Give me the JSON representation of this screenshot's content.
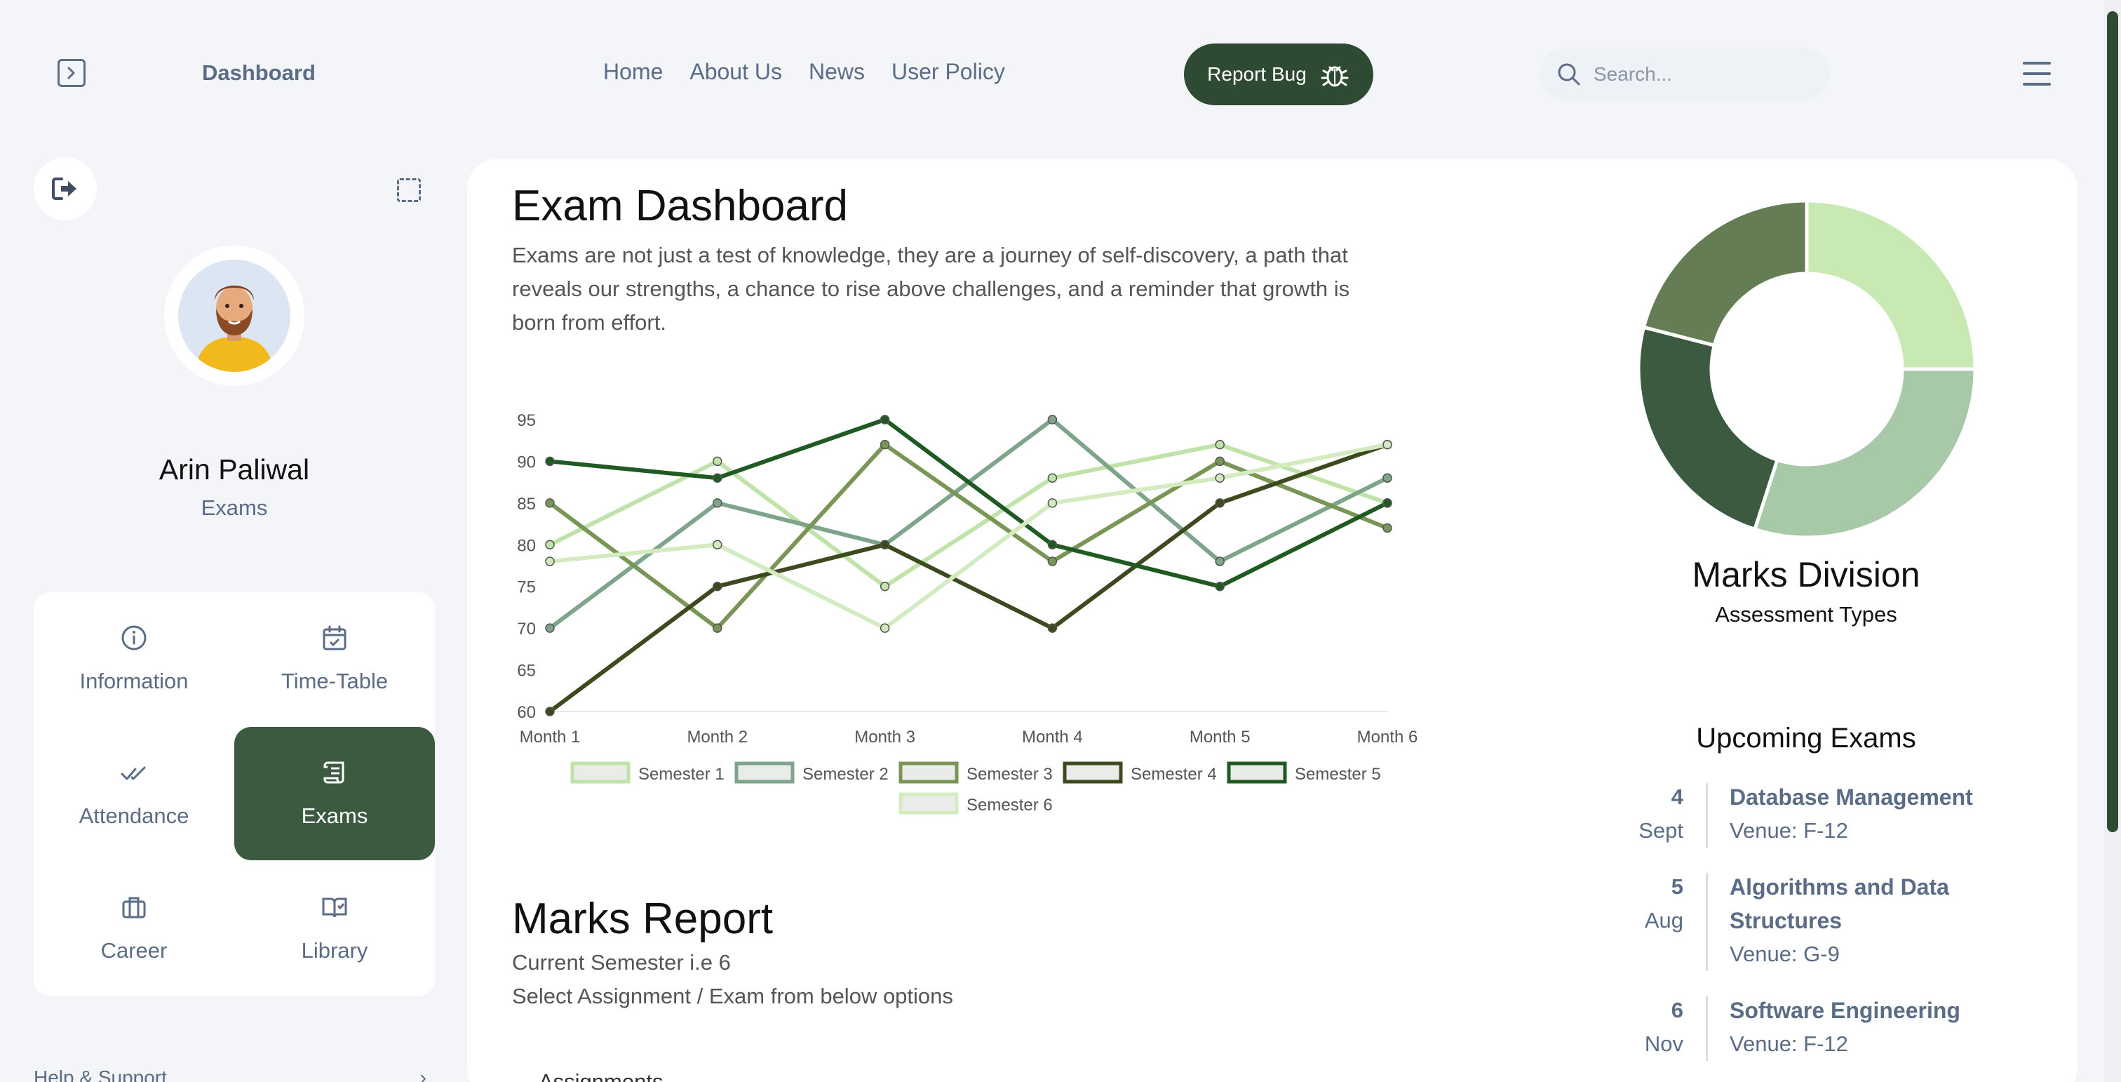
{
  "header": {
    "brand": "Dashboard",
    "nav": [
      "Home",
      "About Us",
      "News",
      "User Policy"
    ],
    "report_bug": "Report Bug",
    "search_placeholder": "Search..."
  },
  "sidebar": {
    "user_name": "Arin Paliwal",
    "user_role": "Exams",
    "menu": [
      {
        "label": "Information",
        "icon": "info-icon"
      },
      {
        "label": "Time-Table",
        "icon": "calendar-icon"
      },
      {
        "label": "Attendance",
        "icon": "double-check-icon"
      },
      {
        "label": "Exams",
        "icon": "scroll-icon",
        "active": true
      },
      {
        "label": "Career",
        "icon": "briefcase-icon"
      },
      {
        "label": "Library",
        "icon": "book-icon"
      }
    ],
    "help": "Help & Support"
  },
  "main": {
    "title": "Exam Dashboard",
    "description": "Exams are not just a test of knowledge, they are a journey of self-discovery, a path that reveals our strengths, a chance to rise above challenges, and a reminder that growth is born from effort.",
    "marks_title": "Marks Report",
    "marks_semester": "Current Semester i.e 6",
    "marks_select": "Select Assignment / Exam from below options",
    "dropdown_value": "Assignments"
  },
  "colors": {
    "accent": "#2f4a33",
    "active_menu": "#3b5a40",
    "muted_text": "#5a6c86"
  },
  "chart_data": [
    {
      "type": "line",
      "x": [
        "Month 1",
        "Month 2",
        "Month 3",
        "Month 4",
        "Month 5",
        "Month 6"
      ],
      "ylim": [
        60,
        95
      ],
      "yticks": [
        60,
        65,
        70,
        75,
        80,
        85,
        90,
        95
      ],
      "legend": "bottom",
      "series": [
        {
          "name": "Semester 1",
          "color": "#bfe3a8",
          "values": [
            80,
            90,
            75,
            88,
            92,
            85
          ]
        },
        {
          "name": "Semester 2",
          "color": "#7ea58b",
          "values": [
            70,
            85,
            80,
            95,
            78,
            88
          ]
        },
        {
          "name": "Semester 3",
          "color": "#7a9656",
          "values": [
            85,
            70,
            92,
            78,
            90,
            82
          ]
        },
        {
          "name": "Semester 4",
          "color": "#3d4a1e",
          "values": [
            60,
            75,
            80,
            70,
            85,
            92
          ]
        },
        {
          "name": "Semester 5",
          "color": "#1f5a22",
          "values": [
            90,
            88,
            95,
            80,
            75,
            85
          ]
        },
        {
          "name": "Semester 6",
          "color": "#d4ebc0",
          "values": [
            78,
            80,
            70,
            85,
            88,
            92
          ]
        }
      ]
    },
    {
      "type": "pie",
      "title": "Marks Division",
      "subtitle": "Assessment Types",
      "values": [
        25,
        30,
        24,
        21
      ],
      "colors": [
        "#c8eab2",
        "#a8c9a8",
        "#3b5a40",
        "#647d55"
      ]
    }
  ],
  "upcoming": {
    "title": "Upcoming Exams",
    "exams": [
      {
        "day": "4",
        "month": "Sept",
        "name": "Database Management",
        "venue": "Venue: F-12"
      },
      {
        "day": "5",
        "month": "Aug",
        "name": "Algorithms and Data Structures",
        "venue": "Venue: G-9"
      },
      {
        "day": "6",
        "month": "Nov",
        "name": "Software Engineering",
        "venue": "Venue: F-12"
      }
    ]
  }
}
